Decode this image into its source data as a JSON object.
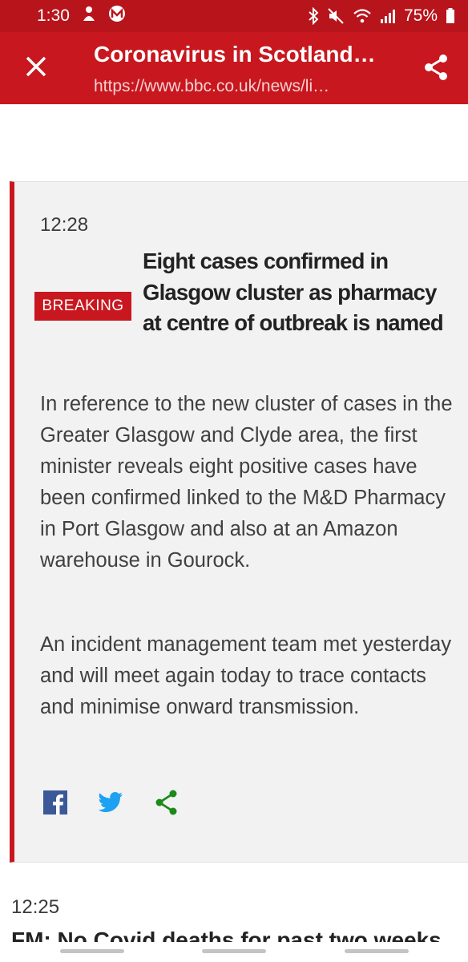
{
  "status_bar": {
    "time": "1:30",
    "battery": "75%",
    "icons": [
      "notification-icon",
      "app-m-icon",
      "bluetooth-icon",
      "mute-icon",
      "wifi-icon",
      "signal-icon",
      "battery-icon"
    ]
  },
  "app_bar": {
    "title": "Coronavirus in Scotland…",
    "url": "https://www.bbc.co.uk/news/li…",
    "close_icon": "close-icon",
    "share_icon": "share-icon"
  },
  "post": {
    "time": "12:28",
    "badge": "BREAKING",
    "headline": "Eight cases confirmed in Glasgow cluster as pharmacy at centre of outbreak is named",
    "paragraphs": [
      "In reference to the new cluster of cases in the Greater Glasgow and Clyde area, the first minister reveals eight positive cases have been confirmed linked to the M&D Pharmacy in Port Glasgow and also at an Amazon warehouse in Gourock.",
      "An incident management team met yesterday and will meet again today to trace contacts and minimise onward transmission."
    ],
    "social": [
      "facebook-icon",
      "twitter-icon",
      "share-icon"
    ]
  },
  "next_post": {
    "time": "12:25",
    "headline": "FM: No Covid deaths for past two weeks"
  },
  "colors": {
    "brand_red": "#c8171e",
    "status_red": "#b8141b",
    "facebook_blue": "#3b5998",
    "twitter_blue": "#1da1f2",
    "share_green": "#1a8a1a"
  }
}
